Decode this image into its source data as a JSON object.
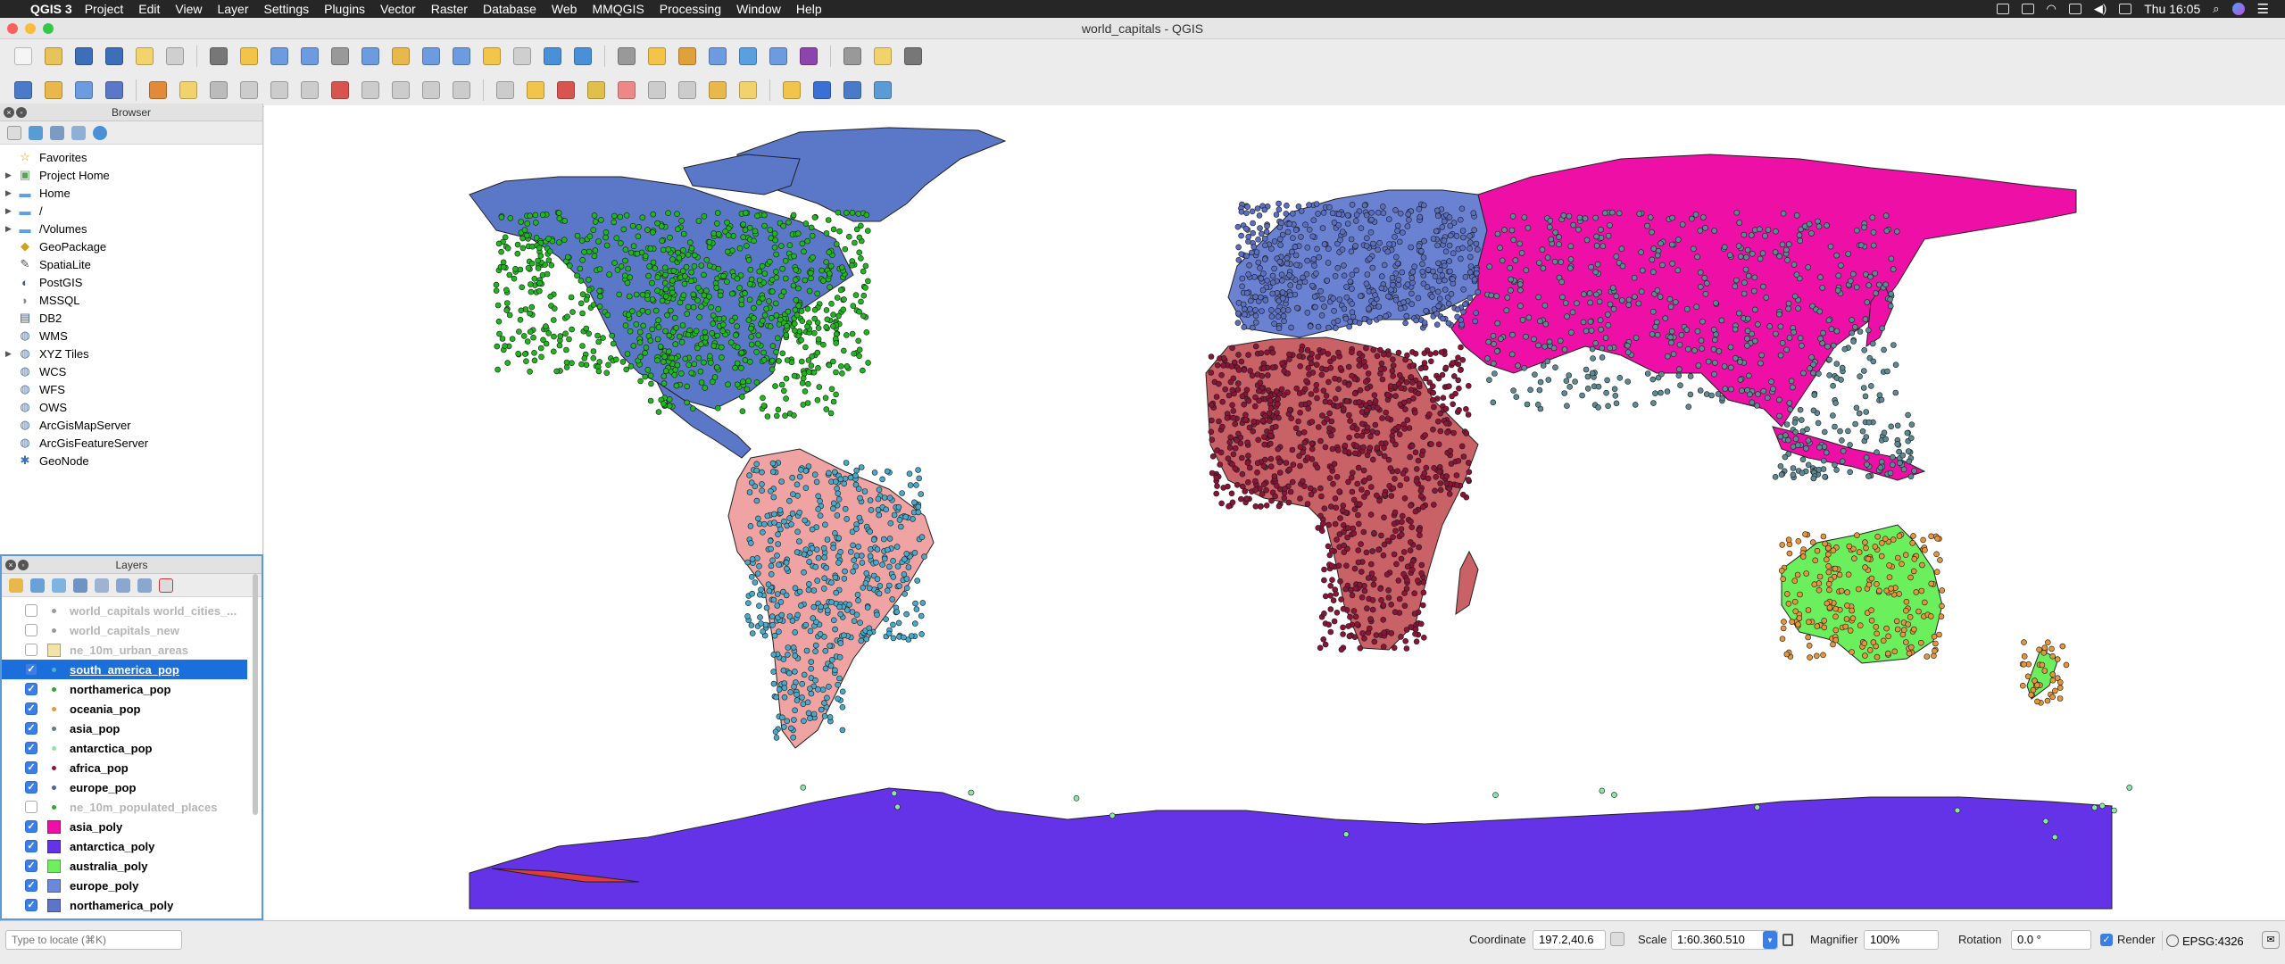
{
  "menubar": {
    "app": "QGIS 3",
    "items": [
      "Project",
      "Edit",
      "View",
      "Layer",
      "Settings",
      "Plugins",
      "Vector",
      "Raster",
      "Database",
      "Web",
      "MMQGIS",
      "Processing",
      "Window",
      "Help"
    ],
    "clock": "Thu 16:05"
  },
  "window": {
    "title": "world_capitals - QGIS"
  },
  "browser": {
    "title": "Browser",
    "items": [
      {
        "label": "Favorites",
        "icon": "star-icon",
        "arrow": false
      },
      {
        "label": "Project Home",
        "icon": "project-home-icon",
        "arrow": true
      },
      {
        "label": "Home",
        "icon": "folder-icon",
        "arrow": true
      },
      {
        "label": "/",
        "icon": "folder-icon",
        "arrow": true
      },
      {
        "label": "/Volumes",
        "icon": "folder-icon",
        "arrow": true
      },
      {
        "label": "GeoPackage",
        "icon": "geopackage-icon",
        "arrow": false
      },
      {
        "label": "SpatiaLite",
        "icon": "spatialite-icon",
        "arrow": false
      },
      {
        "label": "PostGIS",
        "icon": "postgis-icon",
        "arrow": false
      },
      {
        "label": "MSSQL",
        "icon": "mssql-icon",
        "arrow": false
      },
      {
        "label": "DB2",
        "icon": "db2-icon",
        "arrow": false
      },
      {
        "label": "WMS",
        "icon": "globe-icon",
        "arrow": false
      },
      {
        "label": "XYZ Tiles",
        "icon": "globe-icon",
        "arrow": true
      },
      {
        "label": "WCS",
        "icon": "globe-icon",
        "arrow": false
      },
      {
        "label": "WFS",
        "icon": "globe-icon",
        "arrow": false
      },
      {
        "label": "OWS",
        "icon": "globe-icon",
        "arrow": false
      },
      {
        "label": "ArcGisMapServer",
        "icon": "globe-icon",
        "arrow": false
      },
      {
        "label": "ArcGisFeatureServer",
        "icon": "globe-icon",
        "arrow": false
      },
      {
        "label": "GeoNode",
        "icon": "geonode-icon",
        "arrow": false
      }
    ]
  },
  "layers": {
    "title": "Layers",
    "items": [
      {
        "label": "world_capitals world_cities_...",
        "checked": false,
        "kind": "point",
        "color": "#999999"
      },
      {
        "label": "world_capitals_new",
        "checked": false,
        "kind": "point",
        "color": "#999999"
      },
      {
        "label": "ne_10m_urban_areas",
        "checked": false,
        "kind": "poly",
        "color": "#f4e3a6"
      },
      {
        "label": "south_america_pop",
        "checked": true,
        "kind": "point",
        "color": "#4db3c9",
        "selected": true
      },
      {
        "label": "northamerica_pop",
        "checked": true,
        "kind": "point",
        "color": "#2ea82e"
      },
      {
        "label": "oceania_pop",
        "checked": true,
        "kind": "point",
        "color": "#e39a3d"
      },
      {
        "label": "asia_pop",
        "checked": true,
        "kind": "point",
        "color": "#5a7d8c"
      },
      {
        "label": "antarctica_pop",
        "checked": true,
        "kind": "point",
        "color": "#8ee6a6"
      },
      {
        "label": "africa_pop",
        "checked": true,
        "kind": "point",
        "color": "#8b1538"
      },
      {
        "label": "europe_pop",
        "checked": true,
        "kind": "point",
        "color": "#4b5fb3"
      },
      {
        "label": "ne_10m_populated_places",
        "checked": false,
        "kind": "point",
        "color": "#2ea82e"
      },
      {
        "label": "asia_poly",
        "checked": true,
        "kind": "poly",
        "color": "#ee0fa7"
      },
      {
        "label": "antarctica_poly",
        "checked": true,
        "kind": "poly",
        "color": "#6433e8"
      },
      {
        "label": "australia_poly",
        "checked": true,
        "kind": "poly",
        "color": "#6ef05e"
      },
      {
        "label": "europe_poly",
        "checked": true,
        "kind": "poly",
        "color": "#6c88d9"
      },
      {
        "label": "northamerica_poly",
        "checked": true,
        "kind": "poly",
        "color": "#5d74c8"
      }
    ]
  },
  "map": {
    "colors": {
      "north_america": "#5b77c7",
      "south_america": "#f0a3a3",
      "europe": "#6b82d3",
      "africa": "#c86266",
      "asia": "#ee0fa7",
      "australia": "#6cef5c",
      "antarctica": "#6433e8",
      "na_points": "#1eb81e",
      "sa_points": "#4aa9c8",
      "af_points": "#8b1538",
      "as_points": "#5d8a94",
      "eu_points": "#5b6fc0",
      "oc_points": "#e3963a"
    }
  },
  "status": {
    "locator_placeholder": "Type to locate (⌘K)",
    "coordinate_label": "Coordinate",
    "coordinate": "197.2,40.6",
    "scale_label": "Scale",
    "scale": "1:60.360.510",
    "magnifier_label": "Magnifier",
    "magnifier": "100%",
    "rotation_label": "Rotation",
    "rotation": "0.0 °",
    "render_label": "Render",
    "crs": "EPSG:4326"
  }
}
